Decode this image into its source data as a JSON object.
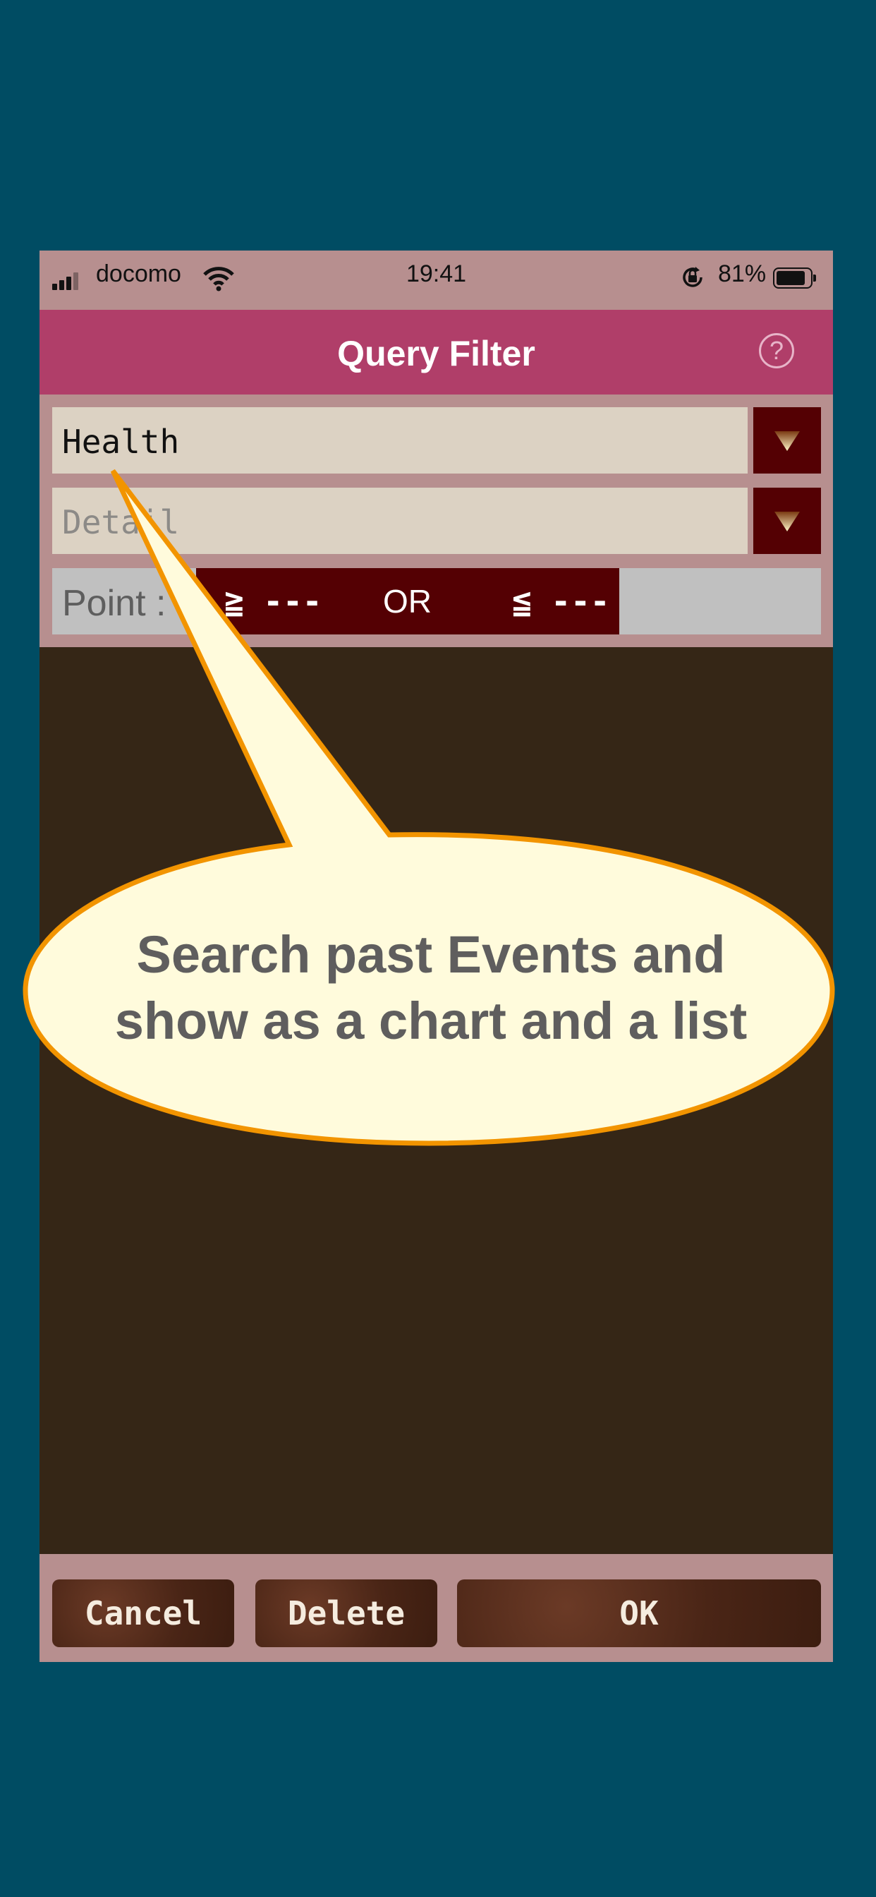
{
  "status_bar": {
    "carrier": "docomo",
    "time": "19:41",
    "battery_percent": "81%"
  },
  "nav": {
    "title": "Query Filter",
    "help_label": "?"
  },
  "filter": {
    "category_value": "Health",
    "detail_placeholder": "Detail",
    "point_label": "Point :",
    "point_min": "≧ ---",
    "point_or": "OR",
    "point_max": "≦ ---"
  },
  "buttons": {
    "cancel": "Cancel",
    "delete": "Delete",
    "ok": "OK"
  },
  "callout": {
    "line1": "Search past Events and",
    "line2": "show as a chart and a list"
  },
  "colors": {
    "background": "#004c63",
    "nav": "#b03e69",
    "panel": "#b78f8f",
    "accent": "#540003",
    "content": "#352616",
    "callout_fill": "#fffbdc",
    "callout_stroke": "#f29400"
  },
  "icons": [
    "signal-icon",
    "wifi-icon",
    "rotation-lock-icon",
    "battery-icon",
    "help-icon",
    "dropdown-arrow-icon"
  ]
}
